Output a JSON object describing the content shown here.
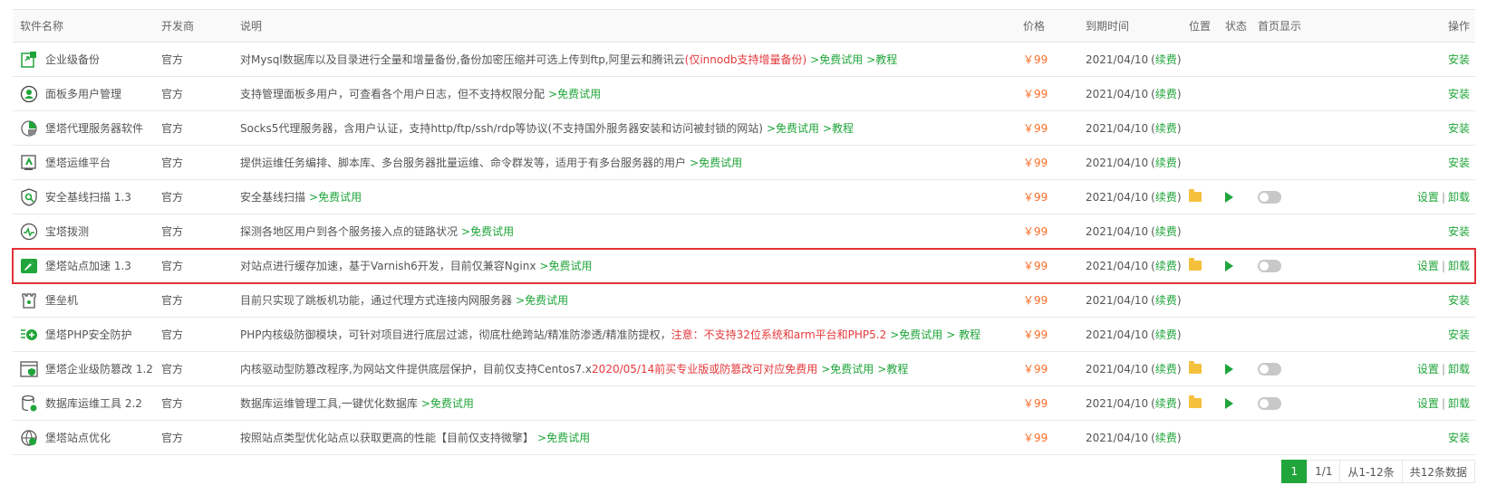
{
  "headers": {
    "name": "软件名称",
    "dev": "开发商",
    "desc": "说明",
    "price": "价格",
    "expire": "到期时间",
    "loc": "位置",
    "status": "状态",
    "home": "首页显示",
    "op": "操作"
  },
  "rows": [
    {
      "icon": "backup-icon",
      "name": "企业级备份",
      "dev": "官方",
      "desc": "对Mysql数据库以及目录进行全量和增量备份,备份加密压缩并可选上传到ftp,阿里云和腾讯云",
      "desc_red": "(仅innodb支持增量备份)",
      "trial": ">免费试用",
      "tutorial": ">教程",
      "price": "￥99",
      "expire": "2021/04/10",
      "renew": "续费",
      "installed": false,
      "op": "安装"
    },
    {
      "icon": "multi-user-icon",
      "name": "面板多用户管理",
      "dev": "官方",
      "desc": "支持管理面板多用户，可查看各个用户日志，但不支持权限分配",
      "desc_red": "",
      "trial": ">免费试用",
      "tutorial": "",
      "price": "￥99",
      "expire": "2021/04/10",
      "renew": "续费",
      "installed": false,
      "op": "安装"
    },
    {
      "icon": "proxy-server-icon",
      "name": "堡塔代理服务器软件",
      "dev": "官方",
      "desc": "Socks5代理服务器，含用户认证，支持http/ftp/ssh/rdp等协议(不支持国外服务器安装和访问被封锁的网站)",
      "desc_red": "",
      "trial": ">免费试用",
      "tutorial": ">教程",
      "price": "￥99",
      "expire": "2021/04/10",
      "renew": "续费",
      "installed": false,
      "op": "安装"
    },
    {
      "icon": "ops-platform-icon",
      "name": "堡塔运维平台",
      "dev": "官方",
      "desc": "提供运维任务编排、脚本库、多台服务器批量运维、命令群发等，适用于有多台服务器的用户",
      "desc_red": "",
      "trial": ">免费试用",
      "tutorial": "",
      "price": "￥99",
      "expire": "2021/04/10",
      "renew": "续费",
      "installed": false,
      "op": "安装"
    },
    {
      "icon": "security-scan-icon",
      "name": "安全基线扫描 1.3",
      "dev": "官方",
      "desc": "安全基线扫描",
      "desc_red": "",
      "trial": ">免费试用",
      "tutorial": "",
      "price": "￥99",
      "expire": "2021/04/10",
      "renew": "续费",
      "installed": true,
      "op_settings": "设置",
      "op_uninstall": "卸载"
    },
    {
      "icon": "dial-test-icon",
      "name": "宝塔拨测",
      "dev": "官方",
      "desc": "探测各地区用户到各个服务接入点的链路状况",
      "desc_red": "",
      "trial": ">免费试用",
      "tutorial": "",
      "price": "￥99",
      "expire": "2021/04/10",
      "renew": "续费",
      "installed": false,
      "op": "安装"
    },
    {
      "icon": "site-accel-icon",
      "name": "堡塔站点加速 1.3",
      "dev": "官方",
      "desc": "对站点进行缓存加速，基于Varnish6开发，目前仅兼容Nginx",
      "desc_red": "",
      "trial": ">免费试用",
      "tutorial": "",
      "price": "￥99",
      "expire": "2021/04/10",
      "renew": "续费",
      "installed": true,
      "highlight": true,
      "op_settings": "设置",
      "op_uninstall": "卸载"
    },
    {
      "icon": "bastion-icon",
      "name": "堡垒机",
      "dev": "官方",
      "desc": "目前只实现了跳板机功能，通过代理方式连接内网服务器",
      "desc_red": "",
      "trial": ">免费试用",
      "tutorial": "",
      "price": "￥99",
      "expire": "2021/04/10",
      "renew": "续费",
      "installed": false,
      "op": "安装"
    },
    {
      "icon": "php-guard-icon",
      "name": "堡塔PHP安全防护",
      "dev": "官方",
      "desc": "PHP内核级防御模块，可针对项目进行底层过滤，彻底杜绝跨站/精准防渗透/精准防提权，",
      "desc_red": "注意：不支持32位系统和arm平台和PHP5.2",
      "trial": ">免费试用",
      "tutorial": "> 教程",
      "price": "￥99",
      "expire": "2021/04/10",
      "renew": "续费",
      "installed": false,
      "op": "安装"
    },
    {
      "icon": "tamper-proof-icon",
      "name": "堡塔企业级防篡改 1.2",
      "dev": "官方",
      "desc": "内核驱动型防篡改程序,为网站文件提供底层保护，目前仅支持Centos7.x ",
      "desc_red": "2020/05/14前买专业版或防篡改可对应免费用",
      "trial": ">免费试用",
      "tutorial": ">教程",
      "price": "￥99",
      "expire": "2021/04/10",
      "renew": "续费",
      "installed": true,
      "op_settings": "设置",
      "op_uninstall": "卸载"
    },
    {
      "icon": "database-tool-icon",
      "name": "数据库运维工具 2.2",
      "dev": "官方",
      "desc": "数据库运维管理工具,一键优化数据库",
      "desc_red": "",
      "trial": ">免费试用",
      "tutorial": "",
      "price": "￥99",
      "expire": "2021/04/10",
      "renew": "续费",
      "installed": true,
      "op_settings": "设置",
      "op_uninstall": "卸载"
    },
    {
      "icon": "site-optimize-icon",
      "name": "堡塔站点优化",
      "dev": "官方",
      "desc": "按照站点类型优化站点以获取更高的性能【目前仅支持微擎】",
      "desc_red": "",
      "trial": ">免费试用",
      "tutorial": "",
      "price": "￥99",
      "expire": "2021/04/10",
      "renew": "续费",
      "installed": false,
      "op": "安装"
    }
  ],
  "pager": {
    "current": "1",
    "pages": "1/1",
    "range": "从1-12条",
    "total": "共12条数据"
  },
  "colors": {
    "accent": "#20a53a",
    "price": "#fc6d26",
    "warn": "#e4393c",
    "highlight_border": "#e0333a"
  }
}
